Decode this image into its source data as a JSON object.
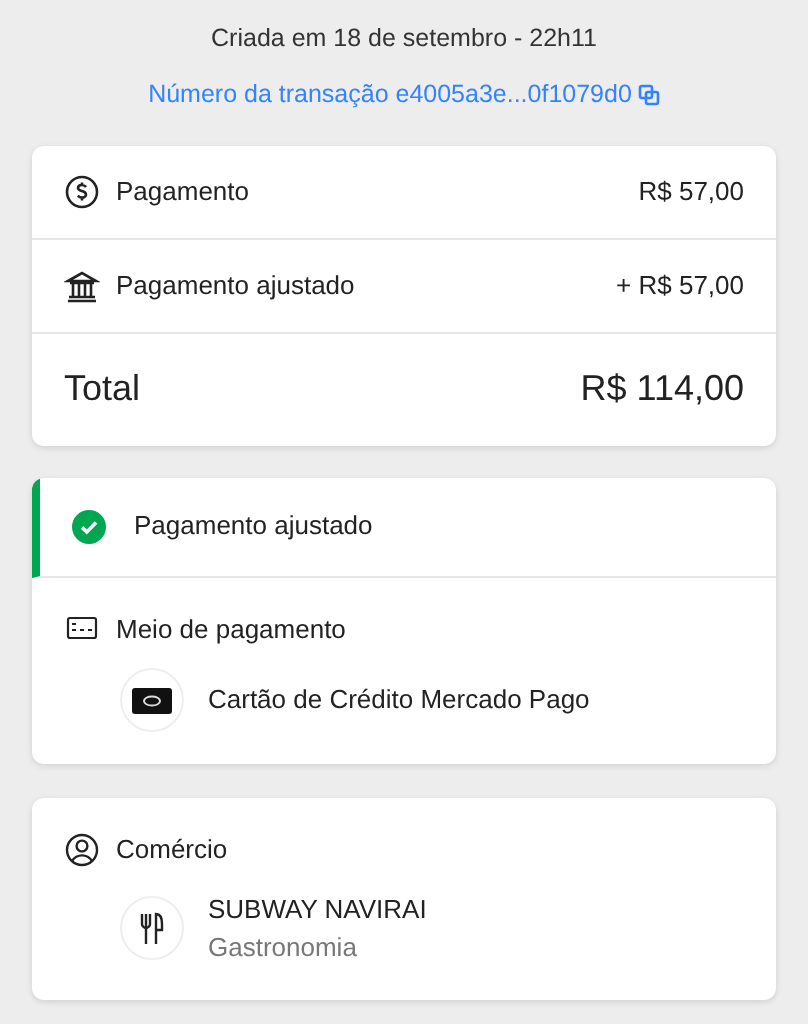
{
  "header": {
    "created": "Criada em 18 de setembro - 22h11",
    "transaction_link": "Número da transação e4005a3e...0f1079d0"
  },
  "summary": {
    "rows": [
      {
        "kind": "payment",
        "label": "Pagamento",
        "amount": "R$ 57,00"
      },
      {
        "kind": "adjusted",
        "label": "Pagamento ajustado",
        "amount": "+ R$ 57,00"
      }
    ],
    "total": {
      "label": "Total",
      "amount": "R$ 114,00"
    }
  },
  "status": {
    "label": "Pagamento ajustado",
    "color": "#00a650"
  },
  "payment_method": {
    "title": "Meio de pagamento",
    "name": "Cartão de Crédito Mercado Pago"
  },
  "merchant": {
    "title": "Comércio",
    "name": "SUBWAY NAVIRAI",
    "category": "Gastronomia"
  }
}
